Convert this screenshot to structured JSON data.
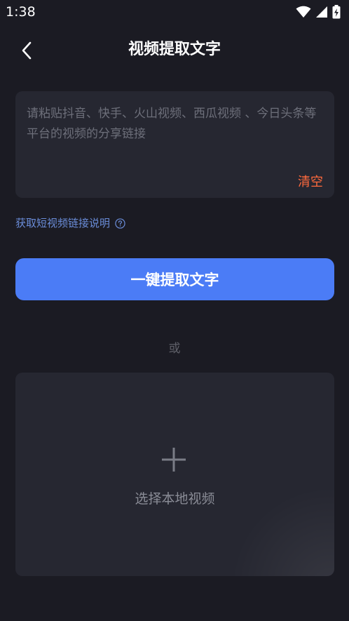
{
  "status_bar": {
    "time": "1:38",
    "icons": [
      "wifi-icon",
      "signal-icon",
      "battery-charging-icon"
    ]
  },
  "header": {
    "back_icon": "chevron-left-icon",
    "title": "视频提取文字"
  },
  "link_input": {
    "placeholder": "请粘贴抖音、快手、火山视频、西瓜视频 、今日头条等平台的视频的分享链接",
    "value": "",
    "clear_label": "清空"
  },
  "help": {
    "text": "获取短视频链接说明",
    "icon": "help-circle-icon"
  },
  "extract_button": {
    "label": "一键提取文字"
  },
  "divider": {
    "text": "或"
  },
  "upload": {
    "icon": "plus-icon",
    "label": "选择本地视频"
  },
  "colors": {
    "background": "#1b1b23",
    "card": "#262731",
    "accent_blue": "#4b7cf6",
    "link_blue": "#6a8cd8",
    "clear_orange": "#ff6a3d",
    "placeholder": "#6d6f7a"
  }
}
